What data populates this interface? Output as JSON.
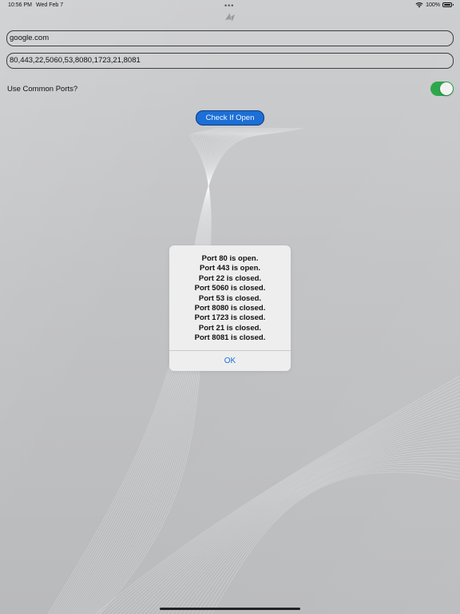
{
  "status_bar": {
    "time": "10:56 PM",
    "date": "Wed Feb 7",
    "battery": "100%"
  },
  "form": {
    "host_value": "google.com",
    "ports_value": "80,443,22,5060,53,8080,1723,21,8081",
    "common_ports_label": "Use Common Ports?",
    "common_ports_enabled": true,
    "check_button_label": "Check If Open"
  },
  "alert": {
    "lines": [
      "Port 80 is open.",
      "Port 443 is open.",
      "Port 22 is closed.",
      "Port 5060 is closed.",
      "Port 53 is closed.",
      "Port 8080 is closed.",
      "Port 1723 is closed.",
      "Port 21 is closed.",
      "Port 8081 is closed."
    ],
    "ok_label": "OK"
  },
  "colors": {
    "accent": "#1b6fd6",
    "toggle_on": "#2ea74c"
  },
  "icons": [
    "wifi-icon",
    "battery-icon",
    "app-logo-icon",
    "multitasking-dots-icon"
  ]
}
